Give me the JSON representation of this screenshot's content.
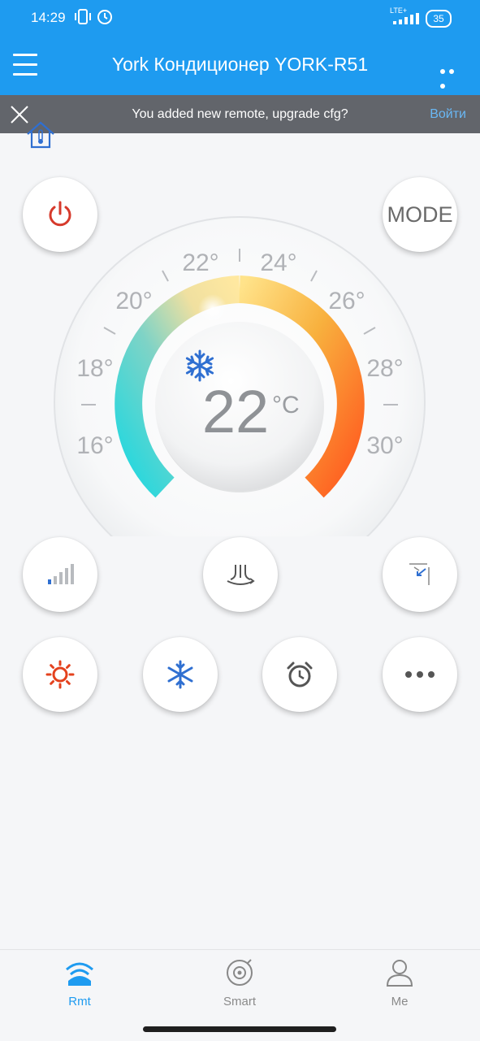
{
  "status": {
    "time": "14:29",
    "network": "LTE+",
    "battery": "35"
  },
  "header": {
    "title": "York Кондиционер YORK-R51"
  },
  "banner": {
    "message": "You added new remote, upgrade cfg?",
    "action": "Войти"
  },
  "controls": {
    "mode_label": "MODE"
  },
  "dial": {
    "current_temp": "22",
    "unit": "°C",
    "scale_labels": [
      "16°",
      "18°",
      "20°",
      "22°",
      "24°",
      "26°",
      "28°",
      "30°"
    ]
  },
  "tabs": [
    {
      "label": "Rmt",
      "active": true
    },
    {
      "label": "Smart",
      "active": false
    },
    {
      "label": "Me",
      "active": false
    }
  ],
  "colors": {
    "accent": "#1e9bf0",
    "power": "#d63a2c",
    "cool": "#2f6fd1",
    "heat": "#e4421e"
  }
}
